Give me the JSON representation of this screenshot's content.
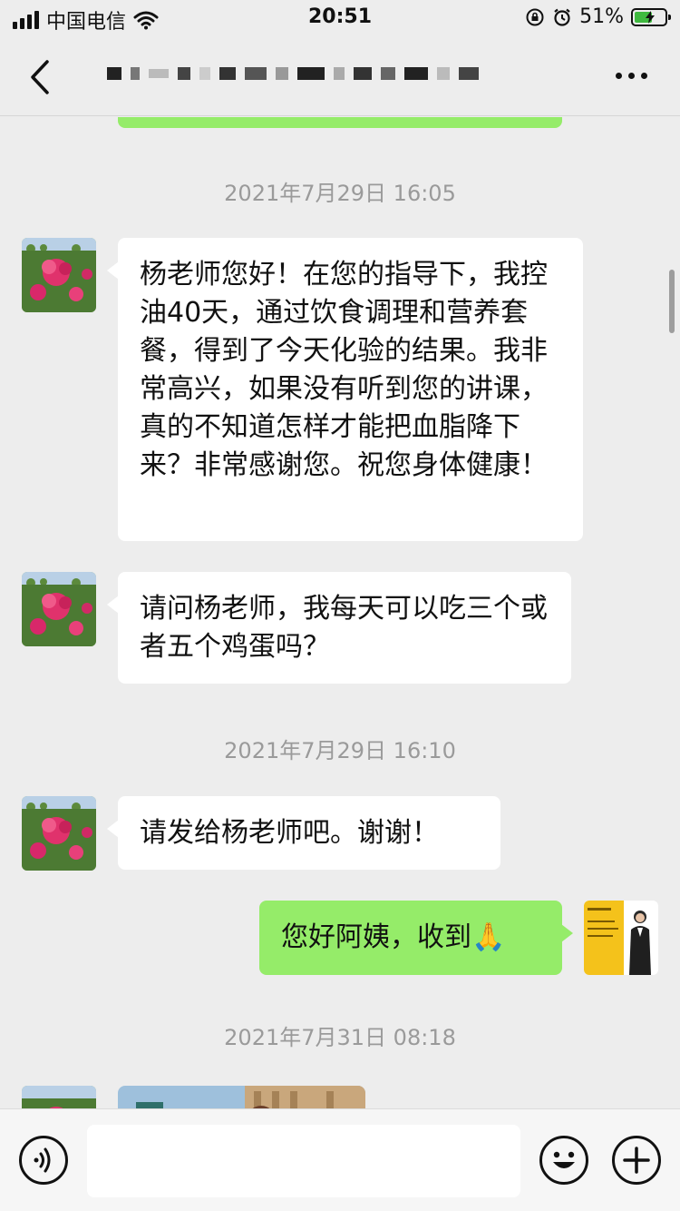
{
  "status_bar": {
    "carrier": "中国电信",
    "time": "20:51",
    "battery_percent": "51%",
    "battery_level": 0.51,
    "icons": [
      "signal-icon",
      "wifi-icon",
      "orientation-lock-icon",
      "alarm-icon",
      "battery-charging-icon"
    ]
  },
  "header": {
    "back_icon": "chevron-left-icon",
    "title_note": "",
    "more_icon": "more-dots-icon"
  },
  "colors": {
    "background": "#ededed",
    "incoming_bubble": "#ffffff",
    "outgoing_bubble": "#95ec69",
    "timestamp_text": "#9a9a9a"
  },
  "chat": {
    "timestamps": [
      "2021年7月29日 16:05",
      "2021年7月29日 16:10",
      "2021年7月31日 08:18"
    ],
    "messages": [
      {
        "direction": "in",
        "avatar": "flower-avatar",
        "text": "杨老师您好！在您的指导下，我控油40天，通过饮食调理和营养套餐，得到了今天化验的结果。我非常高兴，如果没有听到您的讲课，真的不知道怎样才能把血脂降下来？非常感谢您。祝您身体健康！"
      },
      {
        "direction": "in",
        "avatar": "flower-avatar",
        "text": "请问杨老师，我每天可以吃三个或者五个鸡蛋吗？"
      },
      {
        "direction": "in",
        "avatar": "flower-avatar",
        "text": "请发给杨老师吧。谢谢！"
      },
      {
        "direction": "out",
        "avatar": "business-card-avatar",
        "text": "您好阿姨，收到🙏"
      },
      {
        "direction": "in",
        "avatar": "flower-avatar",
        "type": "image-preview",
        "text": ""
      }
    ]
  },
  "input_bar": {
    "voice_icon": "voice-icon",
    "input_value": "",
    "input_placeholder": "",
    "emoji_icon": "emoji-icon",
    "add_icon": "plus-icon"
  }
}
